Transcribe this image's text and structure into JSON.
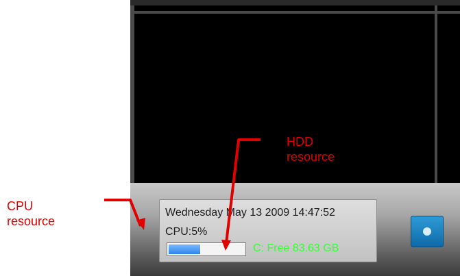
{
  "status_panel": {
    "datetime": "Wednesday May 13 2009 14:47:52",
    "cpu_label": "CPU:5%",
    "cpu_usage_percent": 5,
    "hdd_label": "C: Free 83.63 GB",
    "hdd_color": "#33ff33",
    "bar_color": "#2f86e8"
  },
  "annotations": {
    "cpu_line1": "CPU",
    "cpu_line2": "resource",
    "hdd_line1": "HDD",
    "hdd_line2": "resource",
    "color": "#e00000"
  },
  "side_button": {
    "icon": "record-icon",
    "color": "#1a7fc0"
  }
}
